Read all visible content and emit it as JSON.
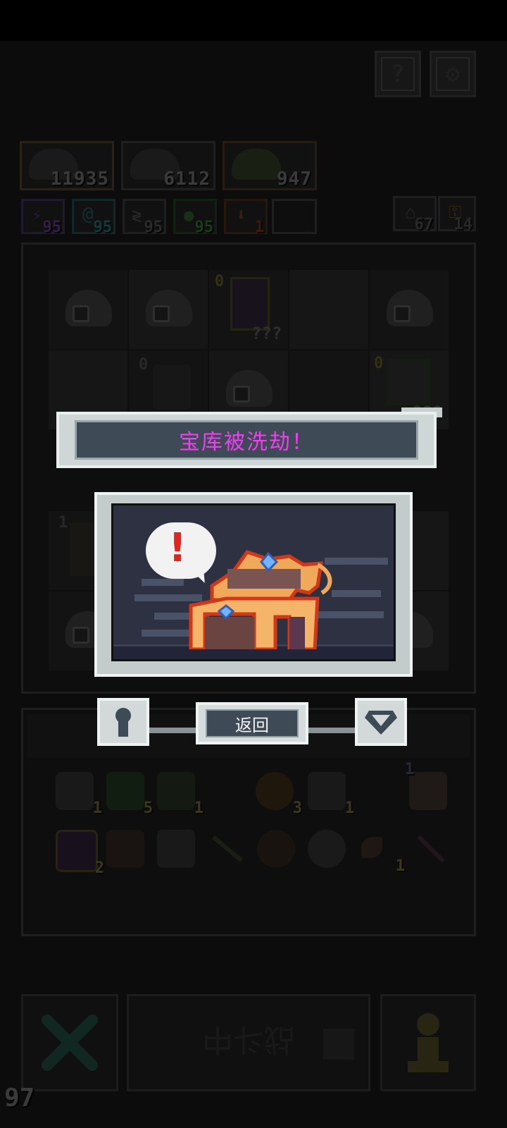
{
  "top_buttons": {
    "help_label": "?",
    "settings_label": "⚙"
  },
  "resources": [
    {
      "icon": "monster-icon",
      "value": "11935"
    },
    {
      "icon": "monster-icon",
      "value": "6112"
    },
    {
      "icon": "slime-icon",
      "value": "947"
    }
  ],
  "badges": [
    {
      "icon": "lightning-icon",
      "value": "95",
      "color": "#7b2fbd"
    },
    {
      "icon": "swirl-icon",
      "value": "95",
      "color": "#1aa3a3"
    },
    {
      "icon": "wings-icon",
      "value": "95",
      "color": "#7a7a7a"
    },
    {
      "icon": "leaf-icon",
      "value": "95",
      "color": "#3c9a3c"
    },
    {
      "icon": "arrow-down-icon",
      "value": "1",
      "color": "#c85a1a"
    }
  ],
  "right_badges": [
    {
      "icon": "house-icon",
      "value": "67"
    },
    {
      "icon": "key-icon",
      "value": "14"
    }
  ],
  "grid_labels": {
    "knight_level": "0",
    "knight_name": "???",
    "statue_level": "0",
    "bunny_level": "0",
    "bunny_name": "???",
    "shaman_level": "1"
  },
  "inventory": [
    {
      "icon": "scroll-icon",
      "count": "1"
    },
    {
      "icon": "green-gem-icon",
      "count": "5"
    },
    {
      "icon": "figure-icon",
      "count": "1"
    },
    {
      "icon": "ring-icon",
      "count": "3"
    },
    {
      "icon": "map-icon",
      "count": "1"
    },
    {
      "icon": "glove-icon",
      "count": "1"
    },
    {
      "icon": "potion-icon",
      "count": "2"
    },
    {
      "icon": "shield-icon",
      "count": ""
    },
    {
      "icon": "claw-icon",
      "count": ""
    },
    {
      "icon": "arrow-icon",
      "count": ""
    },
    {
      "icon": "meat-icon",
      "count": ""
    },
    {
      "icon": "orb-icon",
      "count": ""
    },
    {
      "icon": "axe-icon",
      "count": "1"
    },
    {
      "icon": "wand-icon",
      "count": ""
    }
  ],
  "modal": {
    "title": "宝库被洗劫！",
    "alert_mark": "!",
    "return_label": "返回"
  },
  "bottom_bar": {
    "battle_label": "战斗中",
    "fps": "97"
  },
  "colors": {
    "modal_title": "#f03ef0",
    "chest_gold": "#f0a85a",
    "chest_outline": "#d03818"
  }
}
